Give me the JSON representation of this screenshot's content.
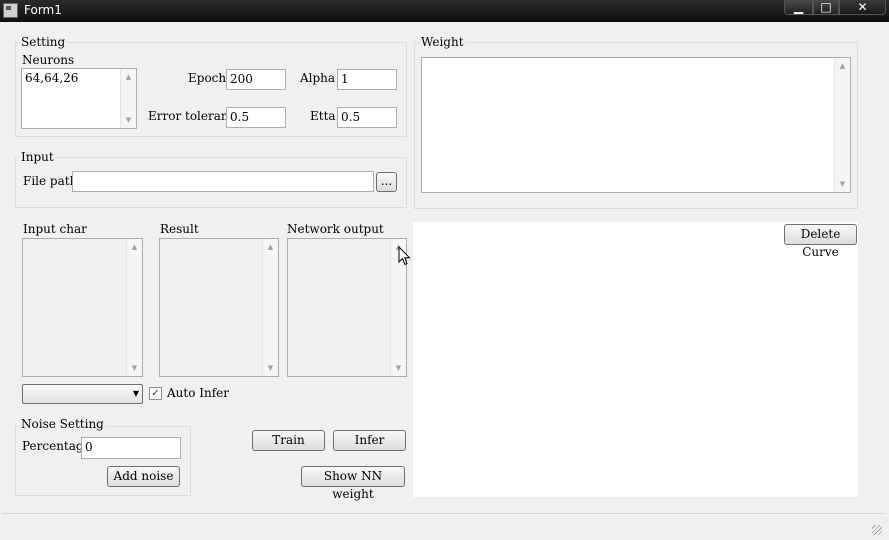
{
  "window": {
    "title": "Form1",
    "min_glyph": "▁",
    "max_glyph": "□",
    "close_glyph": "✕"
  },
  "setting": {
    "title": "Setting",
    "neurons_label": "Neurons",
    "neurons_value": "64,64,26",
    "epoch_label": "Epoch",
    "epoch_value": "200",
    "alpha_label": "Alpha",
    "alpha_value": "1",
    "error_tolerance_label": "Error tolerance",
    "error_tolerance_value": "0.5",
    "etta_label": "Etta",
    "etta_value": "0.5"
  },
  "weight": {
    "title": "Weight"
  },
  "input": {
    "title": "Input",
    "file_path_label": "File path",
    "file_path_value": "",
    "browse_label": "..."
  },
  "lists": {
    "input_char_label": "Input char",
    "result_label": "Result",
    "network_output_label": "Network output"
  },
  "auto_infer": {
    "label": "Auto Infer",
    "checked": true,
    "mark": "✓"
  },
  "noise": {
    "title": "Noise Setting",
    "percentage_label": "Percentage",
    "percentage_value": "0",
    "add_noise_label": "Add noise"
  },
  "actions": {
    "train_label": "Train",
    "infer_label": "Infer",
    "show_weight_label": "Show NN weight"
  },
  "curve": {
    "delete_curve_label": "Delete Curve"
  },
  "icons": {
    "scroll_up": "▲",
    "scroll_down": "▼",
    "dropdown": "▼"
  }
}
